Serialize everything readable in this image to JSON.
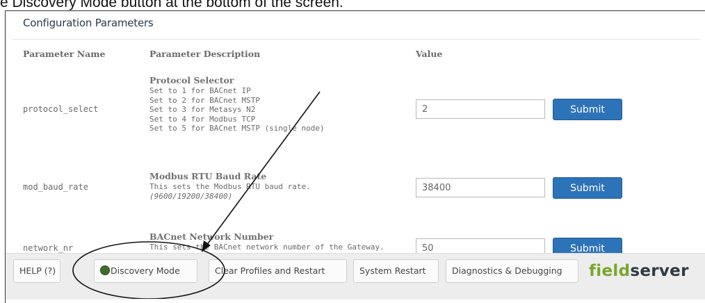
{
  "caption": "e Discovery Mode button at the bottom of the screen.",
  "panel": {
    "title": "Configuration Parameters",
    "headers": {
      "name": "Parameter Name",
      "description": "Parameter Description",
      "value": "Value"
    },
    "rows": [
      {
        "name": "protocol_select",
        "title": "Protocol Selector",
        "lines": [
          "Set to 1 for BACnet IP",
          "Set to 2 for BACnet MSTP",
          "Set to 3 for Metasys N2",
          "Set to 4 for Modbus TCP",
          "Set to 5 for BACnet MSTP (single node)"
        ],
        "value": "2",
        "submit": "Submit"
      },
      {
        "name": "mod_baud_rate",
        "title": "Modbus RTU Baud Rate",
        "lines": [
          "This sets the Modbus RTU baud rate."
        ],
        "note": "(9600/19200/38400)",
        "value": "38400",
        "submit": "Submit"
      },
      {
        "name": "network_nr",
        "title": "BACnet Network Number",
        "lines": [
          "This sets the BACnet network number of the Gateway."
        ],
        "value": "50",
        "submit": "Submit"
      }
    ]
  },
  "bottom": {
    "help": "HELP (?)",
    "discovery": "Discovery Mode",
    "discovery_indicator_color": "#3f6b2a",
    "clear": "Clear Profiles and Restart",
    "restart": "System Restart",
    "diagnostics": "Diagnostics & Debugging",
    "logo_a": "field",
    "logo_b": "server"
  }
}
